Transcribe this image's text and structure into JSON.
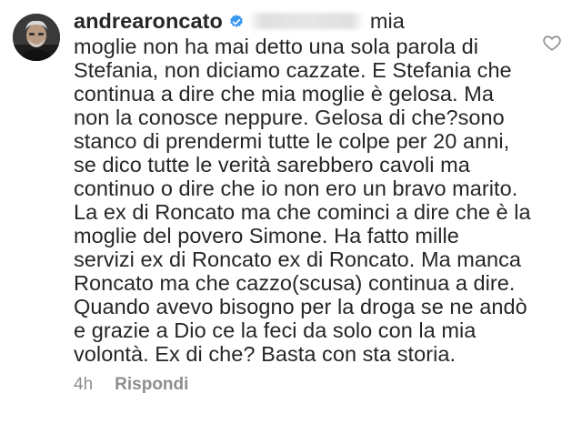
{
  "comment": {
    "username": "andrearoncato",
    "verified_icon": "verified-badge-icon",
    "lines": [
      "mia",
      "moglie non ha mai detto una sola parola di",
      "Stefania, non diciamo cazzate. E Stefania che",
      "continua a dire che mia moglie è gelosa. Ma",
      "non la conosce neppure. Gelosa di che?sono",
      "stanco di prendermi tutte le colpe per 20 anni,",
      "se dico tutte le verità sarebbero cavoli ma",
      "continuo o dire che io non ero un bravo marito.",
      "La ex di Roncato ma che cominci a dire che è la",
      "moglie del povero Simone. Ha fatto mille",
      "servizi ex di Roncato ex di Roncato. Ma manca",
      "Roncato ma che cazzo(scusa) continua a dire.",
      "Quando avevo bisogno per la droga se ne andò",
      "e grazie a Dio ce la feci da solo con la mia",
      "volontà. Ex di che? Basta con sta storia."
    ],
    "time": "4h",
    "reply_label": "Rispondi",
    "like_icon": "heart-outline-icon"
  },
  "colors": {
    "text": "#262626",
    "meta": "#8e8e8e",
    "verified": "#3897f0"
  }
}
